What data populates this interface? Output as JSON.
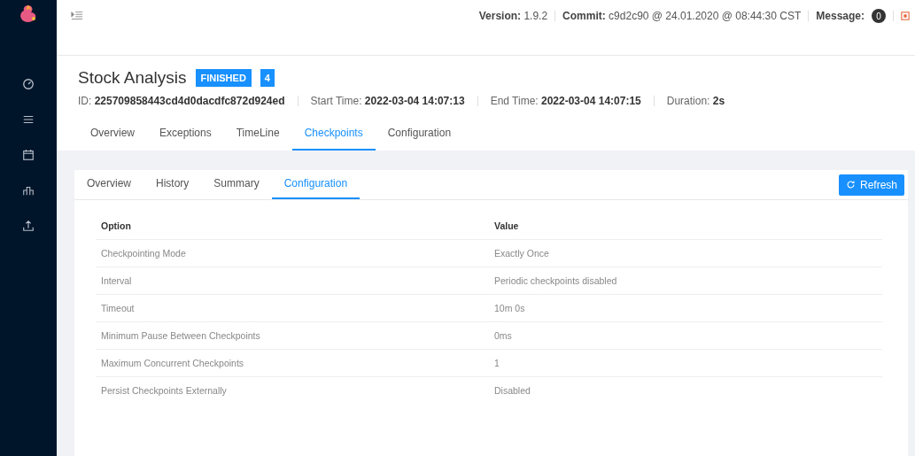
{
  "header": {
    "version_label": "Version:",
    "version": "1.9.2",
    "commit_label": "Commit:",
    "commit": "c9d2c90 @ 24.01.2020 @ 08:44:30 CST",
    "message_label": "Message:",
    "message_count": "0"
  },
  "job": {
    "name": "Stock Analysis",
    "status": "FINISHED",
    "count": "4",
    "meta": [
      {
        "label": "ID:",
        "value": "225709858443cd4d0dacdfc872d924ed"
      },
      {
        "label": "Start Time:",
        "value": "2022-03-04 14:07:13"
      },
      {
        "label": "End Time:",
        "value": "2022-03-04 14:07:15"
      },
      {
        "label": "Duration:",
        "value": "2s"
      }
    ]
  },
  "tabs": [
    {
      "label": "Overview",
      "selected": false
    },
    {
      "label": "Exceptions",
      "selected": false
    },
    {
      "label": "TimeLine",
      "selected": false
    },
    {
      "label": "Checkpoints",
      "selected": true
    },
    {
      "label": "Configuration",
      "selected": false
    }
  ],
  "subtabs": [
    {
      "label": "Overview",
      "selected": false
    },
    {
      "label": "History",
      "selected": false
    },
    {
      "label": "Summary",
      "selected": false
    },
    {
      "label": "Configuration",
      "selected": true
    }
  ],
  "refresh_button": "Refresh",
  "table": {
    "columns": [
      "Option",
      "Value"
    ],
    "rows": [
      [
        "Checkpointing Mode",
        "Exactly Once"
      ],
      [
        "Interval",
        "Periodic checkpoints disabled"
      ],
      [
        "Timeout",
        "10m 0s"
      ],
      [
        "Minimum Pause Between Checkpoints",
        "0ms"
      ],
      [
        "Maximum Concurrent Checkpoints",
        "1"
      ],
      [
        "Persist Checkpoints Externally",
        "Disabled"
      ]
    ]
  }
}
